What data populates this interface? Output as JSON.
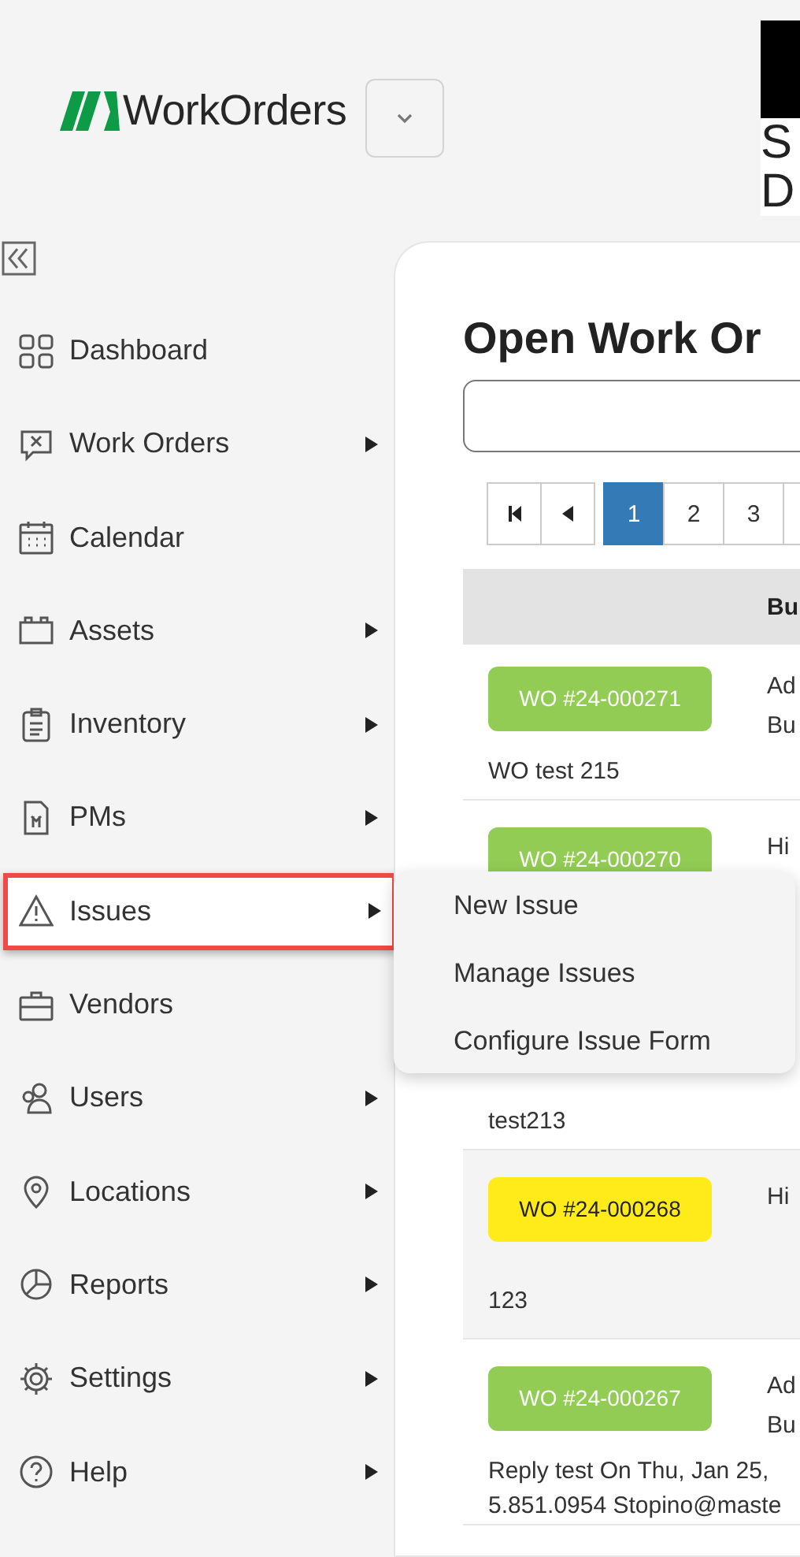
{
  "brand": {
    "logo_text": "WorkOrders",
    "corner_logo": [
      "S",
      "D"
    ]
  },
  "sidebar": {
    "items": [
      {
        "label": "Dashboard",
        "has_submenu": false,
        "selected": false
      },
      {
        "label": "Work Orders",
        "has_submenu": true,
        "selected": false
      },
      {
        "label": "Calendar",
        "has_submenu": false,
        "selected": false
      },
      {
        "label": "Assets",
        "has_submenu": true,
        "selected": false
      },
      {
        "label": "Inventory",
        "has_submenu": true,
        "selected": false
      },
      {
        "label": "PMs",
        "has_submenu": true,
        "selected": false
      },
      {
        "label": "Issues",
        "has_submenu": true,
        "selected": true
      },
      {
        "label": "Vendors",
        "has_submenu": false,
        "selected": false
      },
      {
        "label": "Users",
        "has_submenu": true,
        "selected": false
      },
      {
        "label": "Locations",
        "has_submenu": true,
        "selected": false
      },
      {
        "label": "Reports",
        "has_submenu": true,
        "selected": false
      },
      {
        "label": "Settings",
        "has_submenu": true,
        "selected": false
      },
      {
        "label": "Help",
        "has_submenu": true,
        "selected": false
      }
    ]
  },
  "submenu": {
    "items": [
      "New Issue",
      "Manage Issues",
      "Configure Issue Form"
    ]
  },
  "main": {
    "title": "Open Work Or",
    "pagination": {
      "pages": [
        {
          "label": "1",
          "selected": true
        },
        {
          "label": "2",
          "selected": false
        },
        {
          "label": "3",
          "selected": false
        }
      ]
    },
    "table": {
      "columns": [
        "",
        "Bu"
      ],
      "rows": [
        {
          "badge": "WO #24-000271",
          "color": "#92cc55",
          "column_2": [
            "Ad",
            "Bu"
          ],
          "description": [
            "WO test 215"
          ]
        },
        {
          "badge": "WO #24-000270",
          "color": "#92cc55",
          "column_2": [
            "Hi"
          ],
          "description": [
            "test213"
          ]
        },
        {
          "badge": "WO #24-000268",
          "color": "#ffeb1a",
          "column_2": [
            "Hi"
          ],
          "description": [
            "123"
          ]
        },
        {
          "badge": "WO #24-000267",
          "color": "#92cc55",
          "column_2": [
            "Ad",
            "Bu"
          ],
          "description": [
            "Reply test On Thu, Jan 25,",
            "5.851.0954 Stopino@maste"
          ]
        }
      ]
    }
  }
}
